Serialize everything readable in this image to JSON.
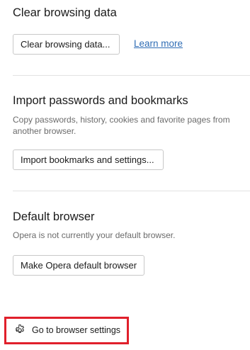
{
  "clear_browsing": {
    "title": "Clear browsing data",
    "button_label": "Clear browsing data...",
    "learn_more_label": "Learn more"
  },
  "import": {
    "title": "Import passwords and bookmarks",
    "description": "Copy passwords, history, cookies and favorite pages from another browser.",
    "button_label": "Import bookmarks and settings..."
  },
  "default_browser": {
    "title": "Default browser",
    "description": "Opera is not currently your default browser.",
    "button_label": "Make Opera default browser"
  },
  "footer": {
    "settings_link_label": "Go to browser settings",
    "settings_icon": "gear-icon",
    "highlight_color": "#e0202b"
  },
  "colors": {
    "link": "#2f6db5",
    "title": "#1b1b1b",
    "description": "#6b6b6b"
  }
}
